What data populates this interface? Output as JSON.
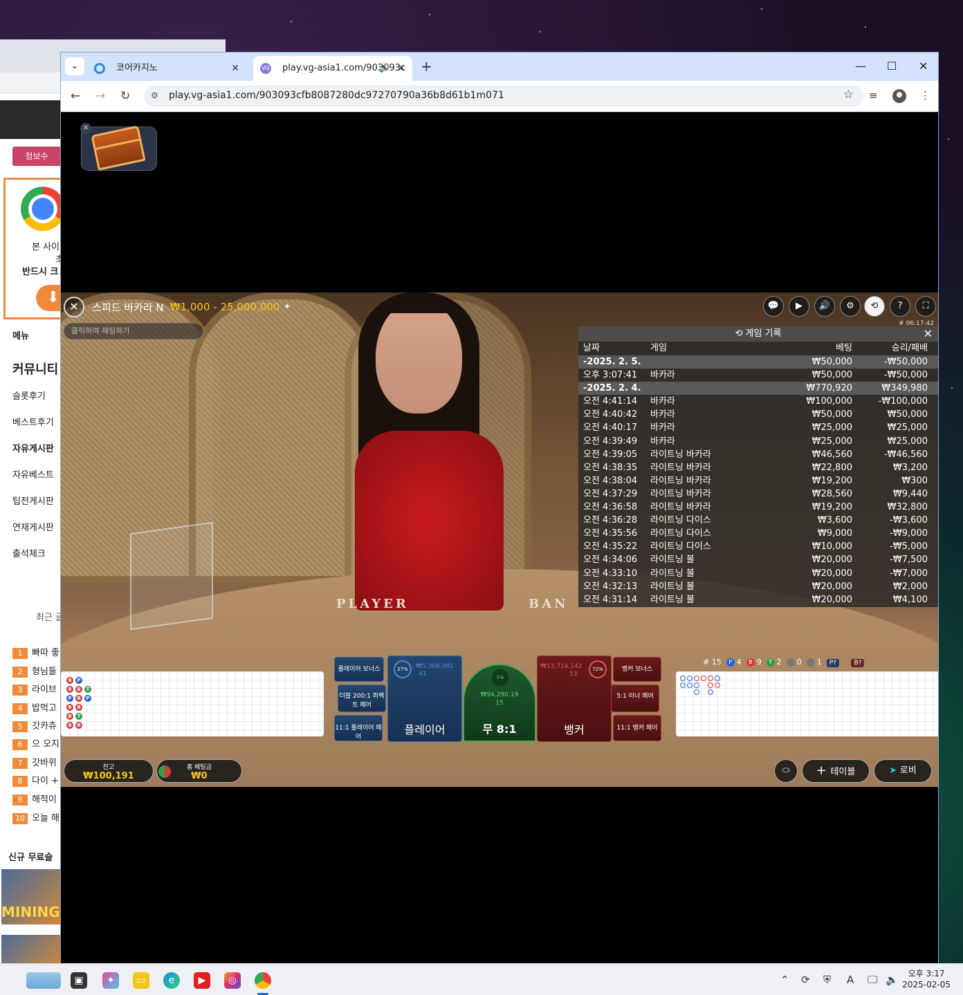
{
  "browser": {
    "tab_menu_icon": "chevron-down-icon",
    "tabs": [
      {
        "title": "코어카지노"
      },
      {
        "title": "play.vg-asia1.com/903093c"
      }
    ],
    "url": "play.vg-asia1.com/903093cfb8087280dc97270790a36b8d61b1m071"
  },
  "background_page": {
    "info_button": "정보수",
    "download_text": [
      "본 사이",
      "초",
      "반드시 크"
    ],
    "menu_label": "메뉴",
    "community_title": "커뮤니티",
    "menu_items": [
      "슬롯후기",
      "베스트후기",
      "자유게시판",
      "자유베스트",
      "팁전게시판",
      "연재게시판",
      "출석체크"
    ],
    "recent_label": "최근 글",
    "ranking": [
      {
        "no": "1",
        "text": "빠따 좋"
      },
      {
        "no": "2",
        "text": "형님들"
      },
      {
        "no": "3",
        "text": "라이브"
      },
      {
        "no": "4",
        "text": "밥먹고"
      },
      {
        "no": "5",
        "text": "갓카츄"
      },
      {
        "no": "6",
        "text": "으 오지"
      },
      {
        "no": "7",
        "text": "갓바위"
      },
      {
        "no": "8",
        "text": "다이 +"
      },
      {
        "no": "9",
        "text": "해적이"
      },
      {
        "no": "10",
        "text": "오늘 해"
      }
    ],
    "new_free_label": "신규 무료슬",
    "thumb_text": "MINING"
  },
  "game": {
    "title": "스피드 바카라 N",
    "limits": "₩1,000 - 25,000,000",
    "chat_placeholder": "클릭하여 채팅하기",
    "round_id": "# 06:17:42",
    "table_text_player": "PLAYER",
    "table_text_banker": "BAN",
    "history": {
      "title": "게임 기록",
      "columns": [
        "날짜",
        "게임",
        "베팅",
        "승리/패배"
      ],
      "rows": [
        {
          "type": "date",
          "c1": "-2025. 2. 5.",
          "c2": "",
          "c3": "₩50,000",
          "c4": "-₩50,000"
        },
        {
          "type": "row",
          "c1": "오후 3:07:41",
          "c2": "바카라",
          "c3": "₩50,000",
          "c4": "-₩50,000"
        },
        {
          "type": "date",
          "c1": "-2025. 2. 4.",
          "c2": "",
          "c3": "₩770,920",
          "c4": "₩349,980"
        },
        {
          "type": "row",
          "c1": "오전 4:41:14",
          "c2": "바카라",
          "c3": "₩100,000",
          "c4": "-₩100,000"
        },
        {
          "type": "row",
          "c1": "오전 4:40:42",
          "c2": "바카라",
          "c3": "₩50,000",
          "c4": "₩50,000"
        },
        {
          "type": "row",
          "c1": "오전 4:40:17",
          "c2": "바카라",
          "c3": "₩25,000",
          "c4": "₩25,000"
        },
        {
          "type": "row",
          "c1": "오전 4:39:49",
          "c2": "바카라",
          "c3": "₩25,000",
          "c4": "₩25,000"
        },
        {
          "type": "row",
          "c1": "오전 4:39:05",
          "c2": "라이트닝 바카라",
          "c3": "₩46,560",
          "c4": "-₩46,560"
        },
        {
          "type": "row",
          "c1": "오전 4:38:35",
          "c2": "라이트닝 바카라",
          "c3": "₩22,800",
          "c4": "₩3,200"
        },
        {
          "type": "row",
          "c1": "오전 4:38:04",
          "c2": "라이트닝 바카라",
          "c3": "₩19,200",
          "c4": "₩300"
        },
        {
          "type": "row",
          "c1": "오전 4:37:29",
          "c2": "라이트닝 바카라",
          "c3": "₩28,560",
          "c4": "₩9,440"
        },
        {
          "type": "row",
          "c1": "오전 4:36:58",
          "c2": "라이트닝 바카라",
          "c3": "₩19,200",
          "c4": "₩32,800"
        },
        {
          "type": "row",
          "c1": "오전 4:36:28",
          "c2": "라이트닝 다이스",
          "c3": "₩3,600",
          "c4": "-₩3,600"
        },
        {
          "type": "row",
          "c1": "오전 4:35:56",
          "c2": "라이트닝 다이스",
          "c3": "₩9,000",
          "c4": "-₩9,000"
        },
        {
          "type": "row",
          "c1": "오전 4:35:22",
          "c2": "라이트닝 다이스",
          "c3": "₩10,000",
          "c4": "-₩5,000"
        },
        {
          "type": "row",
          "c1": "오전 4:34:06",
          "c2": "라이트닝 볼",
          "c3": "₩20,000",
          "c4": "-₩7,500"
        },
        {
          "type": "row",
          "c1": "오전 4:33:10",
          "c2": "라이트닝 볼",
          "c3": "₩20,000",
          "c4": "-₩7,000"
        },
        {
          "type": "row",
          "c1": "오전 4:32:13",
          "c2": "라이트닝 볼",
          "c3": "₩20,000",
          "c4": "₩2,000"
        },
        {
          "type": "row",
          "c1": "오전 4:31:14",
          "c2": "라이트닝 볼",
          "c3": "₩20,000",
          "c4": "₩4,100"
        }
      ]
    },
    "bets": {
      "player_bonus": "플레이어 보너스",
      "either_pair": "더블 200:1 퍼펙트 페어",
      "player_pair": "11:1 플레이어 페어",
      "player": "플레이어",
      "player_pct": "27%",
      "player_amount": "₩5,306,981",
      "player_count": "41",
      "tie": "무 8:1",
      "tie_pct": "1%",
      "tie_amount": "₩94,290.19",
      "tie_count": "15",
      "banker": "뱅커",
      "banker_pct": "72%",
      "banker_amount": "₩13,714,142",
      "banker_count": "53",
      "banker_bonus": "뱅커 보너스",
      "either_pair2": "5:1 이너 페어",
      "banker_pair": "11:1 뱅커 페어"
    },
    "stats": {
      "round": "# 15",
      "p": "4",
      "b": "9",
      "t": "2",
      "pp": "0",
      "bp": "1",
      "p_ask": "P?",
      "b_ask": "B?"
    },
    "balance_label": "잔고",
    "balance": "₩100,191",
    "total_bet_label": "총 베팅금",
    "total_bet": "₩0",
    "table_button": "테이블",
    "lobby_button": "로비",
    "colors": {
      "gold": "#f5c518",
      "player": "#2a62d8",
      "banker": "#d33a3a",
      "tie": "#2f9e4a"
    }
  },
  "taskbar": {
    "time": "오후 3:17",
    "date": "2025-02-05",
    "ime": "A"
  }
}
